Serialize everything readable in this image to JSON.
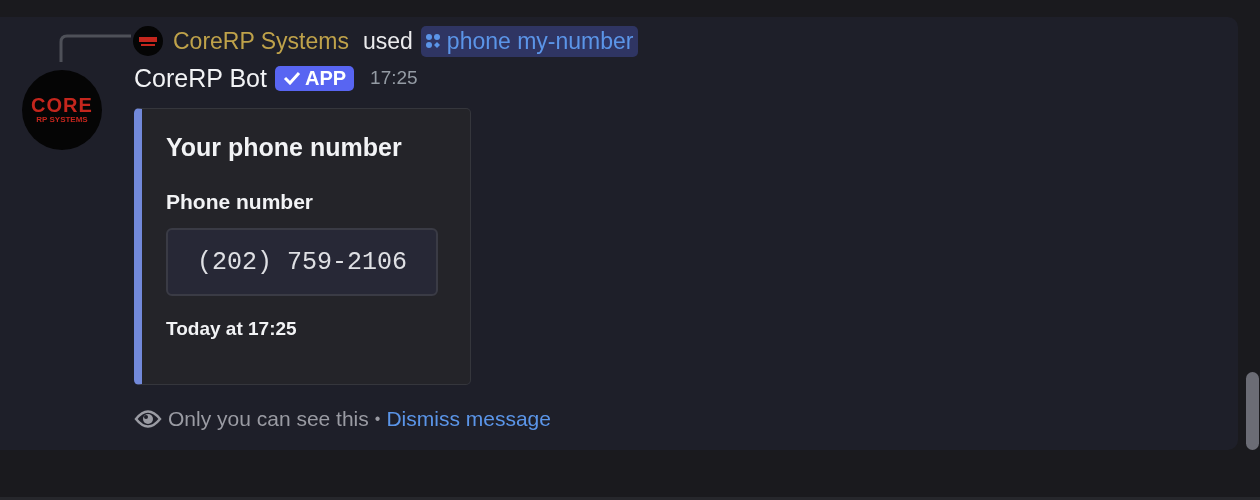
{
  "reply": {
    "author": "CoreRP Systems",
    "verb": "used",
    "command": "phone my-number"
  },
  "message": {
    "author": "CoreRP Bot",
    "badge": "APP",
    "time": "17:25",
    "avatar_logo": {
      "top": "CORE",
      "bottom": "RP SYSTEMS"
    }
  },
  "embed": {
    "title": "Your phone number",
    "fields": [
      {
        "name": "Phone number",
        "value": "(202) 759-2106"
      }
    ],
    "footer": "Today at 17:25"
  },
  "ephemeral": {
    "note": "Only you can see this",
    "separator": "•",
    "link": "Dismiss message"
  }
}
